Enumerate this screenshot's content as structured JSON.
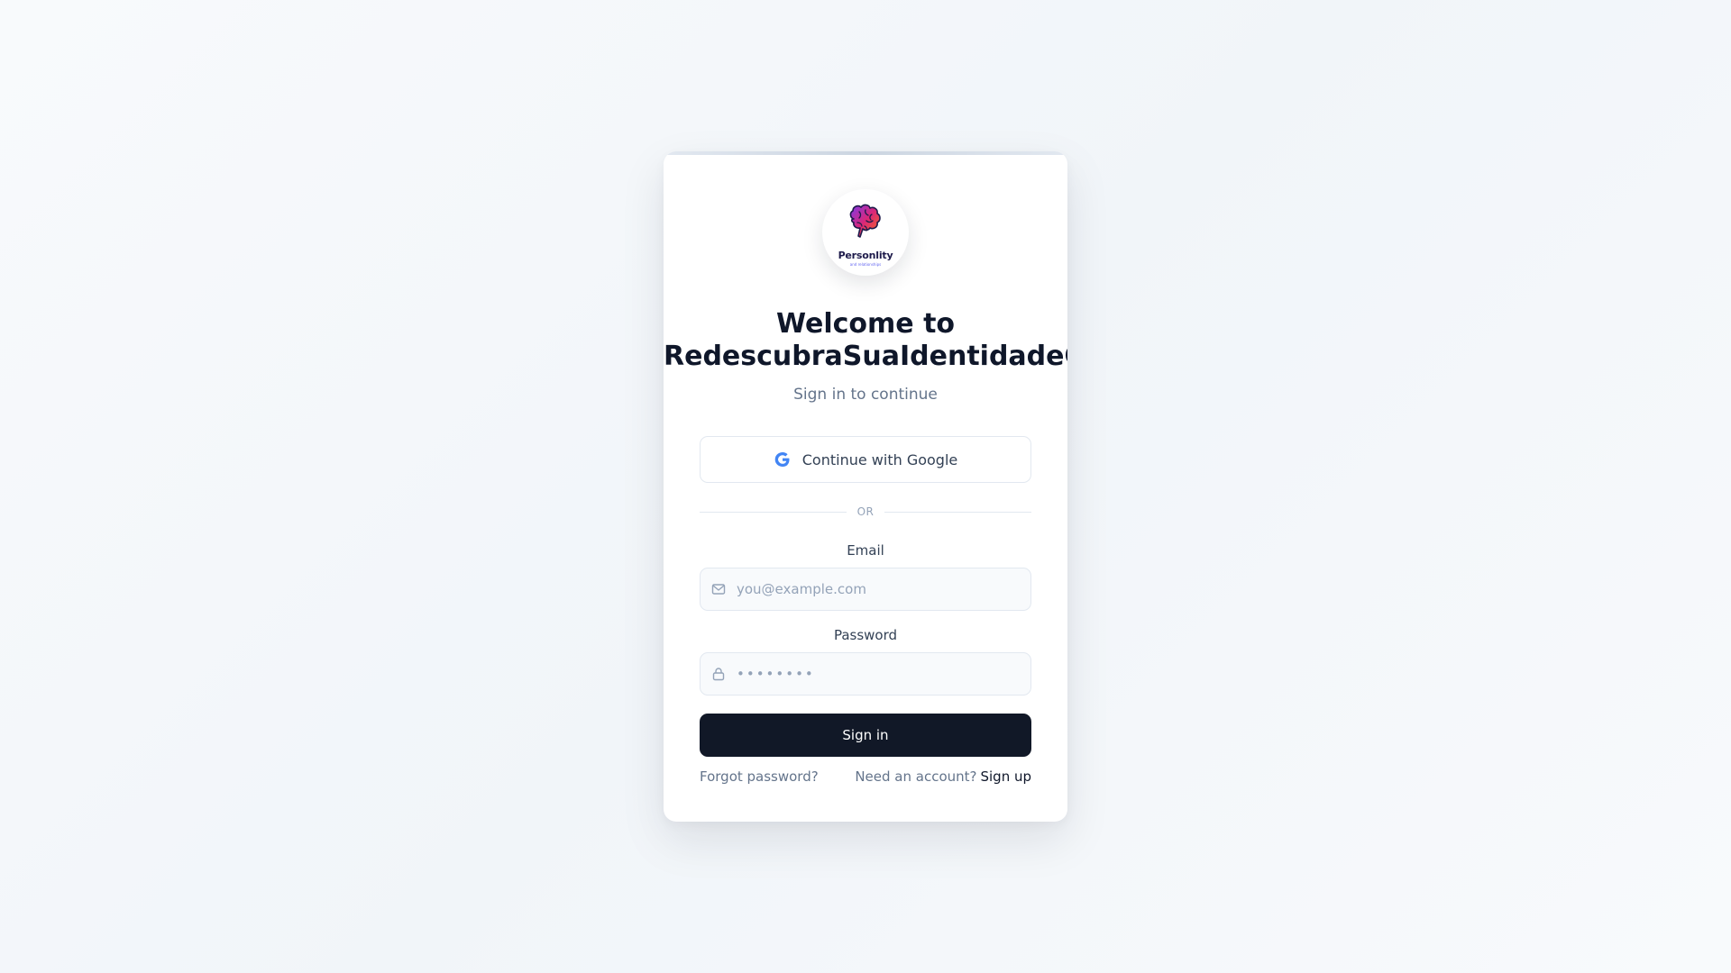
{
  "logo": {
    "name": "Personlity",
    "tagline": "and relationships",
    "icon": "brain-icon"
  },
  "header": {
    "title_line1": "Welcome to",
    "title_line2": "RedescubraSuaIdentidadeCrista",
    "subtitle": "Sign in to continue"
  },
  "google": {
    "label": "Continue with Google",
    "icon": "google-icon"
  },
  "divider": {
    "label": "OR"
  },
  "email": {
    "label": "Email",
    "placeholder": "you@example.com",
    "value": "",
    "icon": "mail-icon"
  },
  "password": {
    "label": "Password",
    "placeholder": "••••••••",
    "value": "",
    "icon": "lock-icon"
  },
  "signin": {
    "label": "Sign in"
  },
  "footer": {
    "forgot": "Forgot password?",
    "need_account": "Need an account?",
    "signup": "Sign up"
  },
  "colors": {
    "primary_button": "#111827",
    "text_dark": "#0f172a",
    "text_muted": "#64748b",
    "border": "#e2e8f0",
    "google_blue": "#4285F4"
  }
}
